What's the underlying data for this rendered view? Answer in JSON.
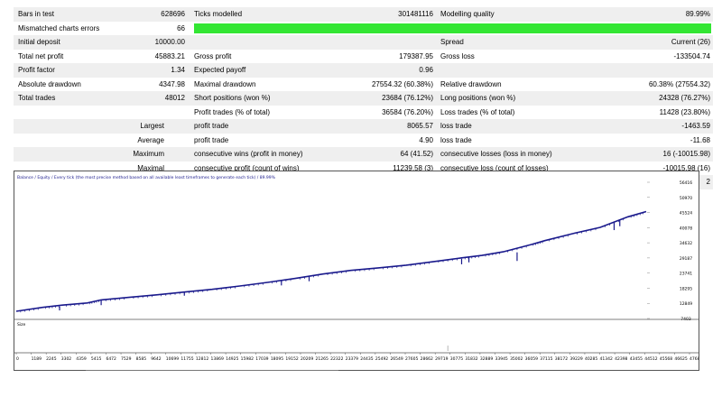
{
  "report": {
    "rows": [
      {
        "l1": "Bars in test",
        "v1": "628696",
        "l2": "Ticks modelled",
        "v2": "301481116",
        "l3": "Modelling quality",
        "v3": "89.99%",
        "alt": true
      },
      {
        "l1": "Mismatched charts errors",
        "v1": "66",
        "quality_bar": 0.8999,
        "alt": false
      },
      {
        "l1": "Initial deposit",
        "v1": "10000.00",
        "l2": "",
        "v2": "",
        "l3": "Spread",
        "v3": "Current (26)",
        "alt": true
      },
      {
        "l1": "Total net profit",
        "v1": "45883.21",
        "l2": "Gross profit",
        "v2": "179387.95",
        "l3": "Gross loss",
        "v3": "-133504.74",
        "alt": false
      },
      {
        "l1": "Profit factor",
        "v1": "1.34",
        "l2": "Expected payoff",
        "v2": "0.96",
        "l3": "",
        "v3": "",
        "alt": true
      },
      {
        "l1": "Absolute drawdown",
        "v1": "4347.98",
        "l2": "Maximal drawdown",
        "v2": "27554.32 (60.38%)",
        "l3": "Relative drawdown",
        "v3": "60.38% (27554.32)",
        "alt": false
      },
      {
        "l1": "Total trades",
        "v1": "48012",
        "l2": "Short positions (won %)",
        "v2": "23684 (76.12%)",
        "l3": "Long positions (won %)",
        "v3": "24328 (76.27%)",
        "alt": true
      },
      {
        "l1": "",
        "v1": "",
        "l2": "Profit trades (% of total)",
        "v2": "36584 (76.20%)",
        "l3": "Loss trades (% of total)",
        "v3": "11428 (23.80%)",
        "alt": false
      },
      {
        "r1": "Largest",
        "l2": "profit trade",
        "v2": "8065.57",
        "l3": "loss trade",
        "v3": "-1463.59",
        "alt": true
      },
      {
        "r1": "Average",
        "l2": "profit trade",
        "v2": "4.90",
        "l3": "loss trade",
        "v3": "-11.68",
        "alt": false
      },
      {
        "r1": "Maximum",
        "l2": "consecutive wins (profit in money)",
        "v2": "64 (41.52)",
        "l3": "consecutive losses (loss in money)",
        "v3": "16 (-10015.98)",
        "alt": true
      },
      {
        "r1": "Maximal",
        "l2": "consecutive profit (count of wins)",
        "v2": "11239.58 (3)",
        "l3": "consecutive loss (count of losses)",
        "v3": "-10015.98 (16)",
        "alt": false
      },
      {
        "r1": "Average",
        "l2": "consecutive wins",
        "v2": "5",
        "l3": "consecutive losses",
        "v3": "2",
        "alt": true
      }
    ]
  },
  "chart_data": {
    "type": "line",
    "legend_text": "Balance / Equity / Every tick (the most precise method based on all available least timeframes to generate each tick) / 89.99%",
    "size_label": "Size",
    "y_ticks": [
      56416,
      50970,
      45524,
      40078,
      34632,
      29187,
      23741,
      18295,
      12849,
      7403
    ],
    "x_ticks": [
      "0",
      "1189",
      "2245",
      "3302",
      "4359",
      "5415",
      "6472",
      "7529",
      "8585",
      "9642",
      "10699",
      "11755",
      "12812",
      "13869",
      "14925",
      "15982",
      "17039",
      "18095",
      "19152",
      "20209",
      "21265",
      "22322",
      "23379",
      "24435",
      "25492",
      "26549",
      "27605",
      "28662",
      "29719",
      "30775",
      "31832",
      "32889",
      "33945",
      "35002",
      "36059",
      "37115",
      "38172",
      "39229",
      "40285",
      "41342",
      "42398",
      "43455",
      "44512",
      "45568",
      "46625",
      "47682"
    ],
    "ylim": [
      7403,
      56416
    ],
    "xlim": [
      0,
      48012
    ],
    "series": [
      {
        "color": "#1a1a8c",
        "points": [
          [
            0,
            10000
          ],
          [
            2000,
            11400
          ],
          [
            3500,
            12200
          ],
          [
            5415,
            13000
          ],
          [
            6472,
            14100
          ],
          [
            8585,
            15000
          ],
          [
            10699,
            15900
          ],
          [
            12812,
            16900
          ],
          [
            14925,
            17900
          ],
          [
            17039,
            19100
          ],
          [
            19152,
            20400
          ],
          [
            21265,
            21800
          ],
          [
            23379,
            23400
          ],
          [
            25492,
            24700
          ],
          [
            27605,
            25600
          ],
          [
            29719,
            26600
          ],
          [
            31832,
            27900
          ],
          [
            33945,
            29200
          ],
          [
            35500,
            30100
          ],
          [
            37115,
            31400
          ],
          [
            39229,
            34000
          ],
          [
            40285,
            35400
          ],
          [
            42398,
            37900
          ],
          [
            44512,
            40200
          ],
          [
            46625,
            44000
          ],
          [
            48012,
            45883
          ]
        ]
      }
    ],
    "drawdown_spikes": [
      [
        3302,
        11700,
        10300
      ],
      [
        6472,
        14000,
        12200
      ],
      [
        12812,
        16900,
        15600
      ],
      [
        20209,
        20900,
        19300
      ],
      [
        22322,
        22600,
        20800
      ],
      [
        33945,
        28900,
        26900
      ],
      [
        34500,
        29600,
        27600
      ],
      [
        38172,
        31200,
        28100
      ],
      [
        45568,
        42200,
        39200
      ],
      [
        46000,
        43000,
        40600
      ]
    ]
  }
}
